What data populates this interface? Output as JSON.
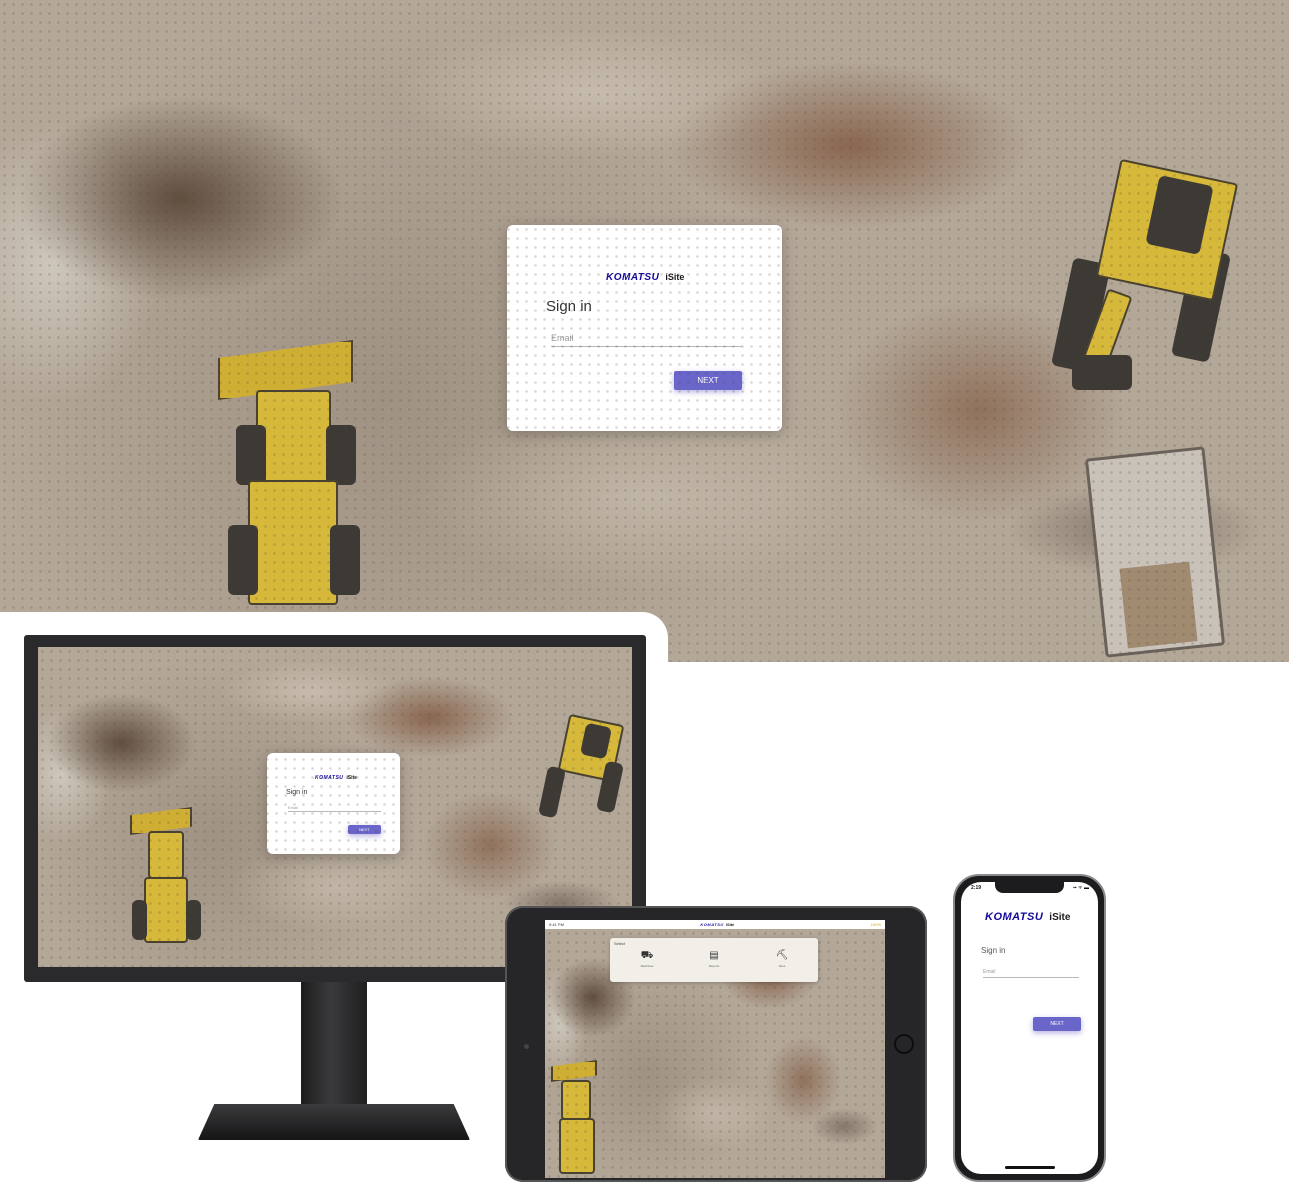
{
  "brand": {
    "name": "KOMATSU",
    "product": "iSite",
    "accent_color": "#6a65c9",
    "logo_color": "#140a9a"
  },
  "signin": {
    "title": "Sign in",
    "email_placeholder": "Email",
    "next_label": "NEXT"
  },
  "tablet": {
    "status_left": "9:41 PM",
    "status_right": "100%",
    "menu_title": "Select",
    "menu_items": [
      {
        "icon": "machine-icon",
        "label": "Machines"
      },
      {
        "icon": "document-icon",
        "label": "Reports"
      },
      {
        "icon": "site-icon",
        "label": "Sites"
      }
    ]
  },
  "phone": {
    "time": "2:19",
    "signal": "▪▪ ᯤ ▬"
  }
}
